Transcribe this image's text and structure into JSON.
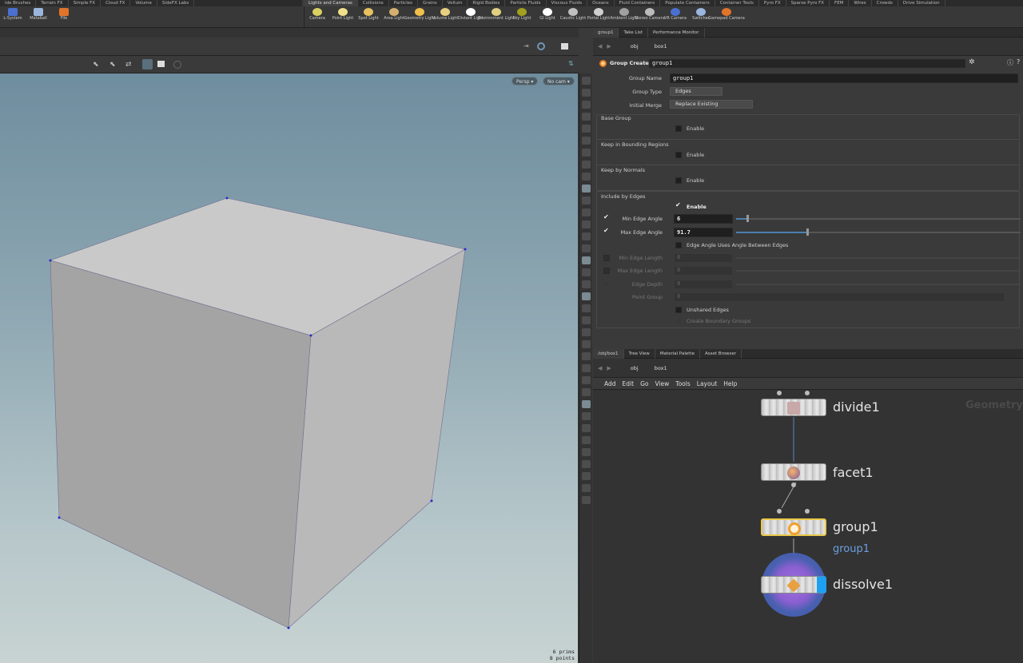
{
  "shelf": {
    "left_tabs": [
      "ide Brushes",
      "Terrain FX",
      "Simple FX",
      "Cloud FX",
      "Volume",
      "SideFX Labs"
    ],
    "right_tabs": [
      "Lights and Cameras",
      "Collisions",
      "Particles",
      "Grains",
      "Vellum",
      "Rigid Bodies",
      "Particle Fluids",
      "Viscous Fluids",
      "Oceans",
      "Fluid Containers",
      "Populate Containers",
      "Container Tools",
      "Pyro FX",
      "Sparse Pyro FX",
      "FEM",
      "Wires",
      "Crowds",
      "Drive Simulation"
    ],
    "left_tools": [
      "L-System",
      "Metaball",
      "File"
    ],
    "right_tools": [
      "Camera",
      "Point Light",
      "Spot Light",
      "Area Light",
      "Geometry Light",
      "Volume Light",
      "Distant Light",
      "Environment Light",
      "Sky Light",
      "GI Light",
      "Caustic Light",
      "Portal Light",
      "Ambient Light",
      "Stereo Camera",
      "VR Camera",
      "Switcher",
      "Gamepad Camera"
    ]
  },
  "viewport": {
    "persp_label": "Persp ▾",
    "cam_label": "No cam ▾",
    "stats_prims": "6  prims",
    "stats_points": "8 points"
  },
  "params_pane": {
    "tabs": [
      "group1",
      "Take List",
      "Performance Monitor"
    ],
    "path_obj": "obj",
    "path_node": "box1",
    "node_type": "Group Create",
    "node_name": "group1",
    "group_name_label": "Group Name",
    "group_name_value": "group1",
    "group_type_label": "Group Type",
    "group_type_value": "Edges",
    "initial_merge_label": "Initial Merge",
    "initial_merge_value": "Replace Existing",
    "base_group": "Base Group",
    "keep_bbox": "Keep in Bounding Regions",
    "keep_normals": "Keep by Normals",
    "include_edges": "Include by Edges",
    "enable": "Enable",
    "min_edge_angle_label": "Min Edge Angle",
    "min_edge_angle_value": "6",
    "min_edge_angle_fraction": 0.04,
    "max_edge_angle_label": "Max Edge Angle",
    "max_edge_angle_value": "91.7",
    "max_edge_angle_fraction": 0.25,
    "edge_angle_between": "Edge Angle Uses Angle Between Edges",
    "min_edge_length_label": "Min Edge Length",
    "min_edge_length_value": "0",
    "max_edge_length_label": "Max Edge Length",
    "max_edge_length_value": "0",
    "edge_depth_label": "Edge Depth",
    "edge_depth_value": "0",
    "point_group_label": "Point Group",
    "point_group_value": "0",
    "unshared_edges": "Unshared Edges",
    "create_boundary": "Create Boundary Groups"
  },
  "network_pane": {
    "tabs": [
      "/obj/box1",
      "Tree View",
      "Material Palette",
      "Asset Browser"
    ],
    "path_obj": "obj",
    "path_node": "box1",
    "menu": [
      "Add",
      "Edit",
      "Go",
      "View",
      "Tools",
      "Layout",
      "Help"
    ],
    "watermark": "Geometry",
    "nodes": [
      {
        "name": "divide1"
      },
      {
        "name": "facet1"
      },
      {
        "name": "group1",
        "sub": "group1"
      },
      {
        "name": "dissolve1"
      }
    ]
  }
}
